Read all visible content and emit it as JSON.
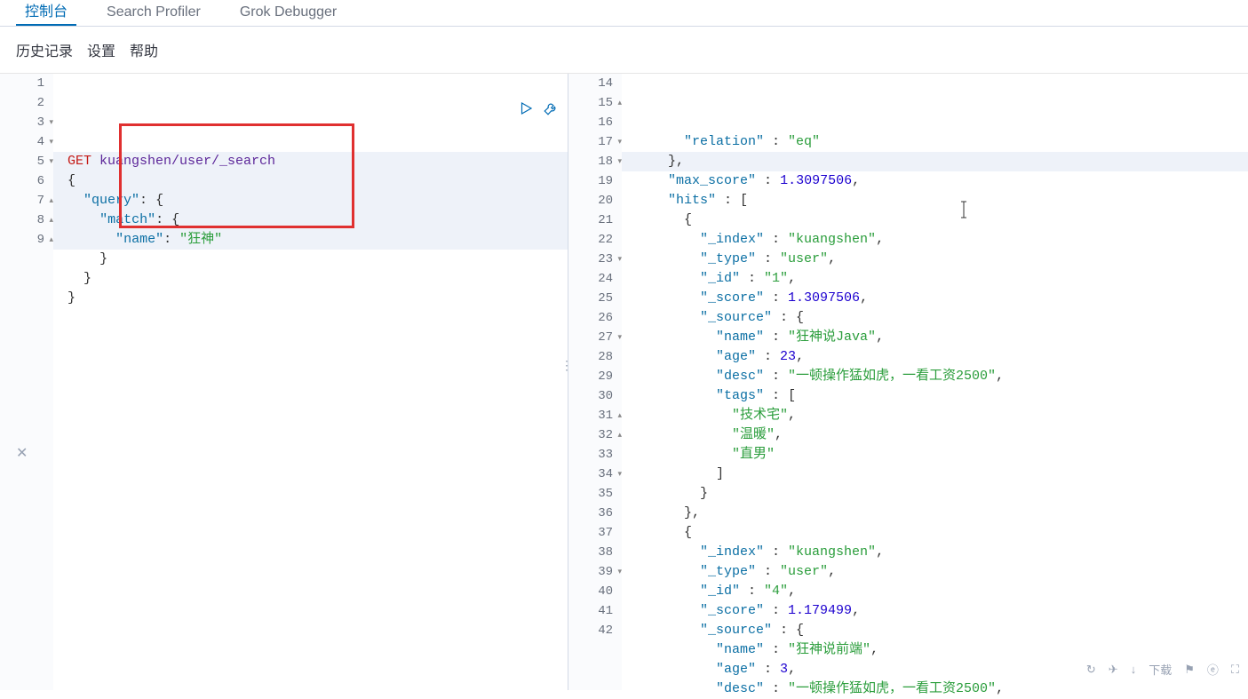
{
  "tabs": {
    "console": "控制台",
    "profiler": "Search Profiler",
    "grok": "Grok Debugger"
  },
  "subnav": {
    "history": "历史记录",
    "settings": "设置",
    "help": "帮助"
  },
  "bottom": {
    "download": "下载"
  },
  "request": {
    "method": "GET",
    "path": "kuangshen/user/_search",
    "body_lines": [
      "{",
      "  \"query\": {",
      "    \"match\": {",
      "      \"name\": \"狂神\"",
      "    }",
      "  }",
      "}"
    ]
  },
  "left_gutter_start": 1,
  "left_gutter_end": 9,
  "right_gutter_start": 14,
  "right_gutter_end": 42,
  "response_lines": [
    {
      "indent": 3,
      "segs": [
        {
          "t": "key",
          "v": "\"relation\""
        },
        {
          "t": "punc",
          "v": " : "
        },
        {
          "t": "str",
          "v": "\"eq\""
        }
      ]
    },
    {
      "indent": 2,
      "segs": [
        {
          "t": "punc",
          "v": "},"
        }
      ],
      "hl": true
    },
    {
      "indent": 2,
      "segs": [
        {
          "t": "key",
          "v": "\"max_score\""
        },
        {
          "t": "punc",
          "v": " : "
        },
        {
          "t": "num",
          "v": "1.3097506"
        },
        {
          "t": "punc",
          "v": ","
        }
      ]
    },
    {
      "indent": 2,
      "segs": [
        {
          "t": "key",
          "v": "\"hits\""
        },
        {
          "t": "punc",
          "v": " : ["
        }
      ]
    },
    {
      "indent": 3,
      "segs": [
        {
          "t": "punc",
          "v": "{"
        }
      ]
    },
    {
      "indent": 4,
      "segs": [
        {
          "t": "key",
          "v": "\"_index\""
        },
        {
          "t": "punc",
          "v": " : "
        },
        {
          "t": "str",
          "v": "\"kuangshen\""
        },
        {
          "t": "punc",
          "v": ","
        }
      ]
    },
    {
      "indent": 4,
      "segs": [
        {
          "t": "key",
          "v": "\"_type\""
        },
        {
          "t": "punc",
          "v": " : "
        },
        {
          "t": "str",
          "v": "\"user\""
        },
        {
          "t": "punc",
          "v": ","
        }
      ]
    },
    {
      "indent": 4,
      "segs": [
        {
          "t": "key",
          "v": "\"_id\""
        },
        {
          "t": "punc",
          "v": " : "
        },
        {
          "t": "str",
          "v": "\"1\""
        },
        {
          "t": "punc",
          "v": ","
        }
      ]
    },
    {
      "indent": 4,
      "segs": [
        {
          "t": "key",
          "v": "\"_score\""
        },
        {
          "t": "punc",
          "v": " : "
        },
        {
          "t": "num",
          "v": "1.3097506"
        },
        {
          "t": "punc",
          "v": ","
        }
      ]
    },
    {
      "indent": 4,
      "segs": [
        {
          "t": "key",
          "v": "\"_source\""
        },
        {
          "t": "punc",
          "v": " : {"
        }
      ]
    },
    {
      "indent": 5,
      "segs": [
        {
          "t": "key",
          "v": "\"name\""
        },
        {
          "t": "punc",
          "v": " : "
        },
        {
          "t": "str",
          "v": "\"狂神说Java\""
        },
        {
          "t": "punc",
          "v": ","
        }
      ]
    },
    {
      "indent": 5,
      "segs": [
        {
          "t": "key",
          "v": "\"age\""
        },
        {
          "t": "punc",
          "v": " : "
        },
        {
          "t": "num",
          "v": "23"
        },
        {
          "t": "punc",
          "v": ","
        }
      ]
    },
    {
      "indent": 5,
      "segs": [
        {
          "t": "key",
          "v": "\"desc\""
        },
        {
          "t": "punc",
          "v": " : "
        },
        {
          "t": "str",
          "v": "\"一顿操作猛如虎，一看工资2500\""
        },
        {
          "t": "punc",
          "v": ","
        }
      ]
    },
    {
      "indent": 5,
      "segs": [
        {
          "t": "key",
          "v": "\"tags\""
        },
        {
          "t": "punc",
          "v": " : ["
        }
      ]
    },
    {
      "indent": 6,
      "segs": [
        {
          "t": "str",
          "v": "\"技术宅\""
        },
        {
          "t": "punc",
          "v": ","
        }
      ]
    },
    {
      "indent": 6,
      "segs": [
        {
          "t": "str",
          "v": "\"温暖\""
        },
        {
          "t": "punc",
          "v": ","
        }
      ]
    },
    {
      "indent": 6,
      "segs": [
        {
          "t": "str",
          "v": "\"直男\""
        }
      ]
    },
    {
      "indent": 5,
      "segs": [
        {
          "t": "punc",
          "v": "]"
        }
      ]
    },
    {
      "indent": 4,
      "segs": [
        {
          "t": "punc",
          "v": "}"
        }
      ]
    },
    {
      "indent": 3,
      "segs": [
        {
          "t": "punc",
          "v": "},"
        }
      ]
    },
    {
      "indent": 3,
      "segs": [
        {
          "t": "punc",
          "v": "{"
        }
      ]
    },
    {
      "indent": 4,
      "segs": [
        {
          "t": "key",
          "v": "\"_index\""
        },
        {
          "t": "punc",
          "v": " : "
        },
        {
          "t": "str",
          "v": "\"kuangshen\""
        },
        {
          "t": "punc",
          "v": ","
        }
      ]
    },
    {
      "indent": 4,
      "segs": [
        {
          "t": "key",
          "v": "\"_type\""
        },
        {
          "t": "punc",
          "v": " : "
        },
        {
          "t": "str",
          "v": "\"user\""
        },
        {
          "t": "punc",
          "v": ","
        }
      ]
    },
    {
      "indent": 4,
      "segs": [
        {
          "t": "key",
          "v": "\"_id\""
        },
        {
          "t": "punc",
          "v": " : "
        },
        {
          "t": "str",
          "v": "\"4\""
        },
        {
          "t": "punc",
          "v": ","
        }
      ]
    },
    {
      "indent": 4,
      "segs": [
        {
          "t": "key",
          "v": "\"_score\""
        },
        {
          "t": "punc",
          "v": " : "
        },
        {
          "t": "num",
          "v": "1.179499"
        },
        {
          "t": "punc",
          "v": ","
        }
      ]
    },
    {
      "indent": 4,
      "segs": [
        {
          "t": "key",
          "v": "\"_source\""
        },
        {
          "t": "punc",
          "v": " : {"
        }
      ]
    },
    {
      "indent": 5,
      "segs": [
        {
          "t": "key",
          "v": "\"name\""
        },
        {
          "t": "punc",
          "v": " : "
        },
        {
          "t": "str",
          "v": "\"狂神说前端\""
        },
        {
          "t": "punc",
          "v": ","
        }
      ]
    },
    {
      "indent": 5,
      "segs": [
        {
          "t": "key",
          "v": "\"age\""
        },
        {
          "t": "punc",
          "v": " : "
        },
        {
          "t": "num",
          "v": "3"
        },
        {
          "t": "punc",
          "v": ","
        }
      ]
    },
    {
      "indent": 5,
      "segs": [
        {
          "t": "key",
          "v": "\"desc\""
        },
        {
          "t": "punc",
          "v": " : "
        },
        {
          "t": "str",
          "v": "\"一顿操作猛如虎，一看工资2500\""
        },
        {
          "t": "punc",
          "v": ","
        }
      ]
    }
  ],
  "fold_left": {
    "3": "d",
    "4": "d",
    "5": "d",
    "7": "u",
    "8": "u",
    "9": "u"
  },
  "fold_right": {
    "15": "u",
    "17": "d",
    "18": "d",
    "23": "d",
    "27": "d",
    "31": "u",
    "32": "u",
    "34": "d",
    "39": "d"
  }
}
